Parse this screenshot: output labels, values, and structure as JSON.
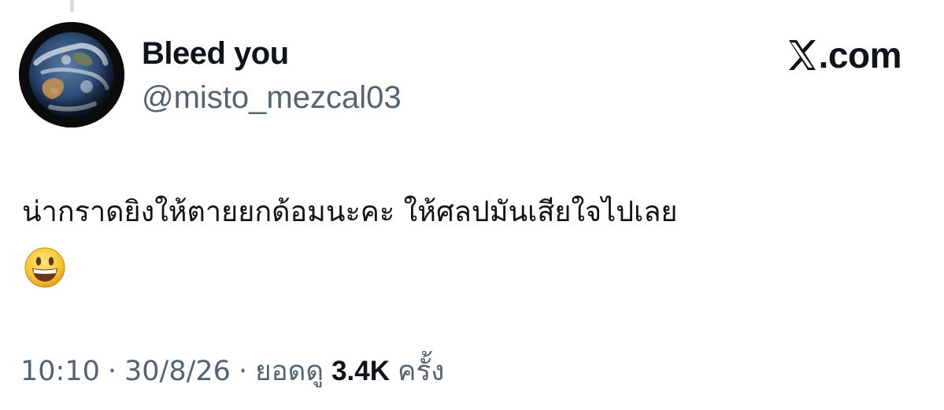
{
  "author": {
    "display_name": "Bleed you",
    "handle": "@misto_mezcal03",
    "avatar_icon": "earth-globe-avatar"
  },
  "brand": {
    "icon": "x-logo-icon",
    "text": ".com"
  },
  "tweet": {
    "text": "น่ากราดยิงให้ตายยกด้อมนะคะ ให้ศลปมันเสียใจไปเลย",
    "emoji": "grinning-face-emoji"
  },
  "meta": {
    "time": "10:10",
    "separator": "·",
    "date": "30/8/26",
    "views_label": "ยอดดู",
    "views_count": "3.4K",
    "views_suffix": "ครั้ง"
  },
  "colors": {
    "primary_text": "#0f1419",
    "secondary_text": "#536471",
    "background": "#ffffff"
  }
}
